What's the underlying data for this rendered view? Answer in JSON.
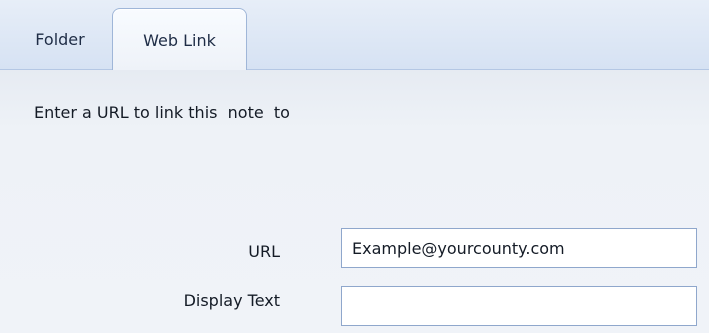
{
  "tabs": [
    {
      "label": "Folder",
      "selected": false
    },
    {
      "label": "Web Link",
      "selected": true
    }
  ],
  "content": {
    "intro_text": "Enter a URL to link this  note  to"
  },
  "form": {
    "url": {
      "label": "URL",
      "value": "Example@yourcounty.com"
    },
    "display_text": {
      "label": "Display Text",
      "value": ""
    }
  },
  "colors": {
    "tab_strip": "#d6e2f3",
    "content_bg": "#eff2f7",
    "input_border": "#8fa7cc"
  }
}
